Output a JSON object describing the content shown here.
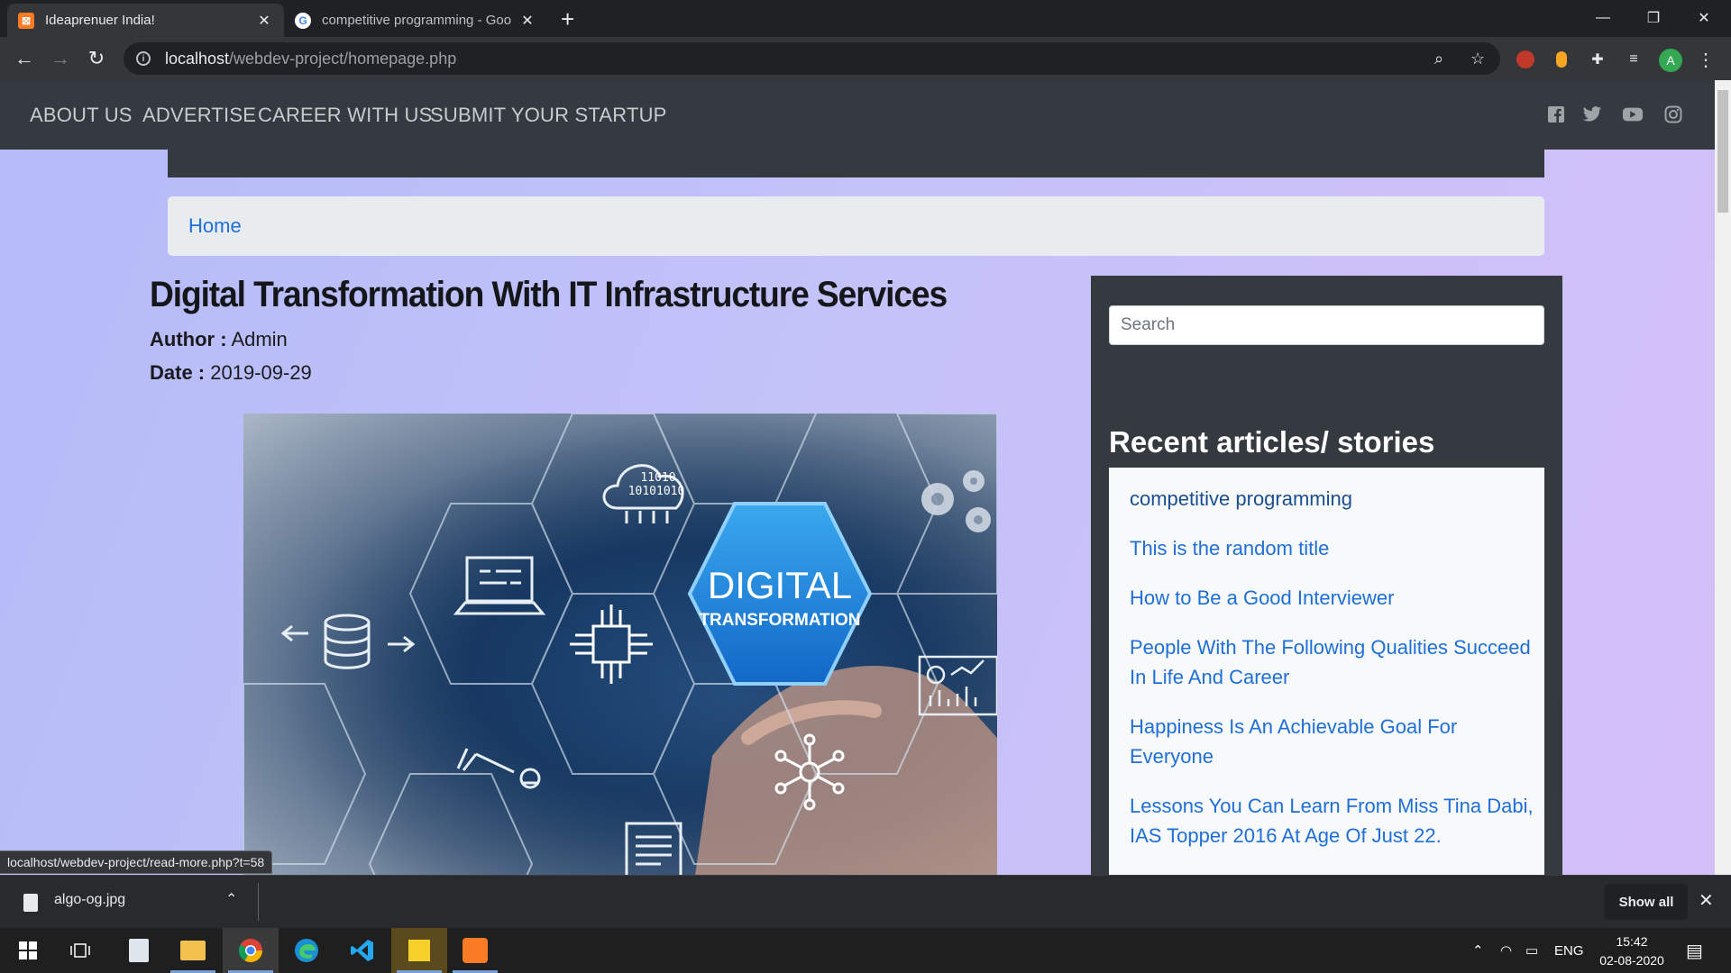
{
  "browser": {
    "tabs": [
      {
        "title": "Ideaprenuer India!",
        "favicon": "xampp-icon",
        "active": true
      },
      {
        "title": "competitive programming - Goo",
        "favicon": "google-icon",
        "active": false
      }
    ],
    "url_host": "localhost",
    "url_path": "/webdev-project/homepage.php",
    "profile_initial": "A"
  },
  "site": {
    "nav": [
      "ABOUT US",
      "ADVERTISE",
      "CAREER WITH US",
      "SUBMIT YOUR STARTUP"
    ],
    "social_icons": [
      "facebook-icon",
      "twitter-icon",
      "youtube-icon",
      "instagram-icon"
    ],
    "breadcrumb": "Home"
  },
  "article": {
    "title": "Digital Transformation With IT Infrastructure Services",
    "author_label": "Author :",
    "author": "Admin",
    "date_label": "Date :",
    "date": "2019-09-29",
    "image": {
      "main_text": "DIGITAL",
      "sub_text": "TRANSFORMATION",
      "binary_1": "11010",
      "binary_2": "10101010"
    }
  },
  "sidebar": {
    "search_placeholder": "Search",
    "recent_heading": "Recent articles/ stories",
    "recent": [
      "competitive programming",
      "This is the random title",
      "How to Be a Good Interviewer",
      "People With The Following Qualities Succeed In Life And Career",
      "Happiness Is An Achievable Goal For Everyone",
      "Lessons You Can Learn From Miss Tina Dabi, IAS Topper 2016 At Age Of Just 22."
    ]
  },
  "status_url": "localhost/webdev-project/read-more.php?t=58",
  "downloads": {
    "file": "algo-og.jpg",
    "show_all": "Show all"
  },
  "taskbar": {
    "lang": "ENG",
    "time": "15:42",
    "date": "02-08-2020"
  }
}
